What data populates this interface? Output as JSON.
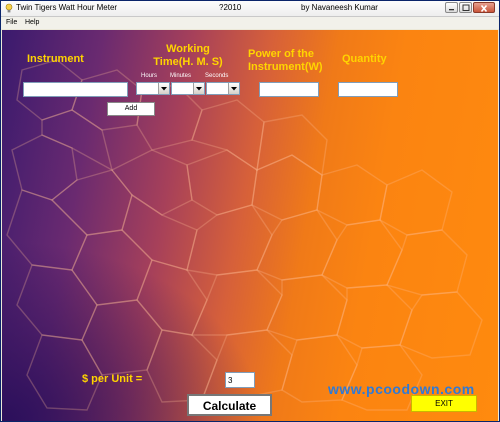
{
  "window": {
    "title": "Twin Tigers Watt Hour Meter",
    "year": "?2010",
    "author": "by Navaneesh Kumar"
  },
  "menu": {
    "items": [
      "File",
      "Help"
    ]
  },
  "form": {
    "instrument_label": "Instrument",
    "working_time_label_line1": "Working",
    "working_time_label_line2": "Time(H. M. S)",
    "hours_label": "Hours",
    "minutes_label": "Minutes",
    "seconds_label": "Seconds",
    "power_label_line1": "Power of the",
    "power_label_line2": "Instrument(W)",
    "quantity_label": "Quantity",
    "instrument_value": "",
    "hours_value": "",
    "minutes_value": "",
    "seconds_value": "",
    "power_value": "",
    "quantity_value": "",
    "add_button": "Add"
  },
  "footer": {
    "per_unit_label": "$ per Unit =",
    "per_unit_value": "3",
    "calculate_button": "Calculate",
    "exit_button": "EXIT",
    "watermark": "www.pcoodown.com"
  },
  "colors": {
    "label": "#ffd400",
    "exit_bg": "#ffff00",
    "watermark": "#2f7ad6"
  }
}
